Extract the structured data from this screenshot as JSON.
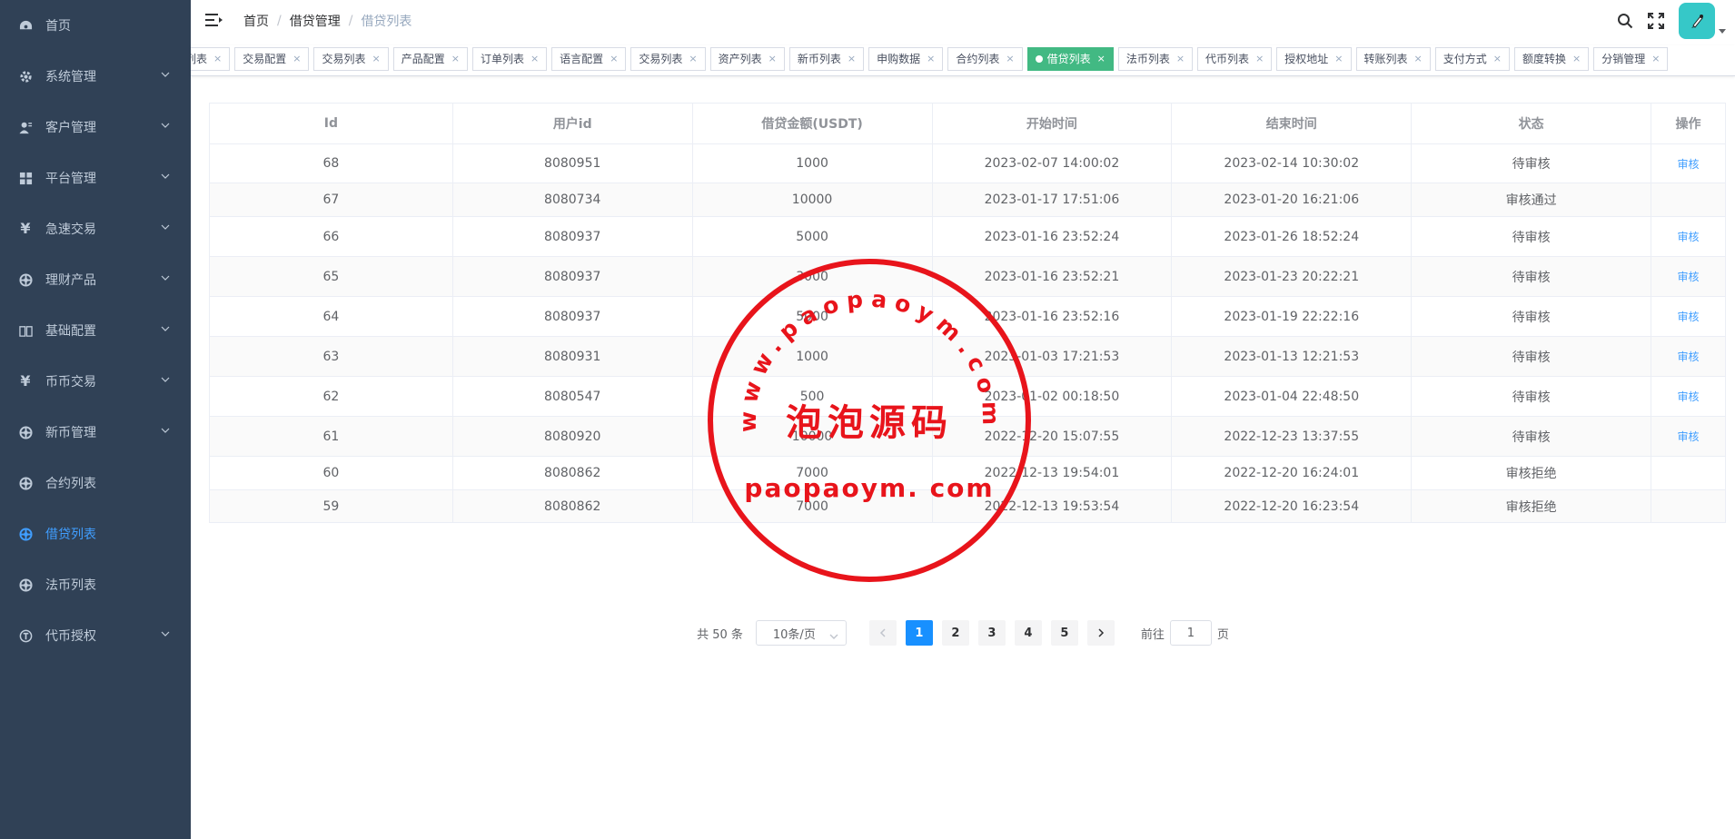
{
  "sidebar": {
    "items": [
      {
        "label": "首页",
        "icon": "dashboard-icon",
        "has_arrow": false,
        "active": false
      },
      {
        "label": "系统管理",
        "icon": "gear-icon",
        "has_arrow": true,
        "active": false
      },
      {
        "label": "客户管理",
        "icon": "user-icon",
        "has_arrow": true,
        "active": false
      },
      {
        "label": "平台管理",
        "icon": "grid-icon",
        "has_arrow": true,
        "active": false
      },
      {
        "label": "急速交易",
        "icon": "yen-icon",
        "has_arrow": true,
        "active": false
      },
      {
        "label": "理财产品",
        "icon": "aperture-icon",
        "has_arrow": true,
        "active": false
      },
      {
        "label": "基础配置",
        "icon": "book-icon",
        "has_arrow": true,
        "active": false
      },
      {
        "label": "币币交易",
        "icon": "yen-icon",
        "has_arrow": true,
        "active": false
      },
      {
        "label": "新币管理",
        "icon": "aperture-icon",
        "has_arrow": true,
        "active": false
      },
      {
        "label": "合约列表",
        "icon": "aperture-icon",
        "has_arrow": false,
        "active": false
      },
      {
        "label": "借贷列表",
        "icon": "aperture-icon",
        "has_arrow": false,
        "active": true
      },
      {
        "label": "法币列表",
        "icon": "aperture-icon",
        "has_arrow": false,
        "active": false
      },
      {
        "label": "代币授权",
        "icon": "token-icon",
        "has_arrow": true,
        "active": false
      }
    ]
  },
  "breadcrumb": [
    "首页",
    "借贷管理",
    "借贷列表"
  ],
  "tags": [
    {
      "label": "列表",
      "active": false
    },
    {
      "label": "交易配置",
      "active": false
    },
    {
      "label": "交易列表",
      "active": false
    },
    {
      "label": "产品配置",
      "active": false
    },
    {
      "label": "订单列表",
      "active": false
    },
    {
      "label": "语言配置",
      "active": false
    },
    {
      "label": "交易列表",
      "active": false
    },
    {
      "label": "资产列表",
      "active": false
    },
    {
      "label": "新币列表",
      "active": false
    },
    {
      "label": "申购数据",
      "active": false
    },
    {
      "label": "合约列表",
      "active": false
    },
    {
      "label": "借贷列表",
      "active": true
    },
    {
      "label": "法币列表",
      "active": false
    },
    {
      "label": "代币列表",
      "active": false
    },
    {
      "label": "授权地址",
      "active": false
    },
    {
      "label": "转账列表",
      "active": false
    },
    {
      "label": "支付方式",
      "active": false
    },
    {
      "label": "额度转换",
      "active": false
    },
    {
      "label": "分销管理",
      "active": false
    }
  ],
  "table": {
    "columns": [
      "Id",
      "用户id",
      "借贷金额(USDT)",
      "开始时间",
      "结束时间",
      "状态",
      "操作"
    ],
    "rows": [
      {
        "id": "68",
        "user_id": "8080951",
        "amount": "1000",
        "start": "2023-02-07 14:00:02",
        "end": "2023-02-14 10:30:02",
        "status": "待审核",
        "action": "审核"
      },
      {
        "id": "67",
        "user_id": "8080734",
        "amount": "10000",
        "start": "2023-01-17 17:51:06",
        "end": "2023-01-20 16:21:06",
        "status": "审核通过",
        "action": ""
      },
      {
        "id": "66",
        "user_id": "8080937",
        "amount": "5000",
        "start": "2023-01-16 23:52:24",
        "end": "2023-01-26 18:52:24",
        "status": "待审核",
        "action": "审核"
      },
      {
        "id": "65",
        "user_id": "8080937",
        "amount": "3000",
        "start": "2023-01-16 23:52:21",
        "end": "2023-01-23 20:22:21",
        "status": "待审核",
        "action": "审核"
      },
      {
        "id": "64",
        "user_id": "8080937",
        "amount": "5000",
        "start": "2023-01-16 23:52:16",
        "end": "2023-01-19 22:22:16",
        "status": "待审核",
        "action": "审核"
      },
      {
        "id": "63",
        "user_id": "8080931",
        "amount": "1000",
        "start": "2023-01-03 17:21:53",
        "end": "2023-01-13 12:21:53",
        "status": "待审核",
        "action": "审核"
      },
      {
        "id": "62",
        "user_id": "8080547",
        "amount": "500",
        "start": "2023-01-02 00:18:50",
        "end": "2023-01-04 22:48:50",
        "status": "待审核",
        "action": "审核"
      },
      {
        "id": "61",
        "user_id": "8080920",
        "amount": "10000",
        "start": "2022-12-20 15:07:55",
        "end": "2022-12-23 13:37:55",
        "status": "待审核",
        "action": "审核"
      },
      {
        "id": "60",
        "user_id": "8080862",
        "amount": "7000",
        "start": "2022-12-13 19:54:01",
        "end": "2022-12-20 16:24:01",
        "status": "审核拒绝",
        "action": ""
      },
      {
        "id": "59",
        "user_id": "8080862",
        "amount": "7000",
        "start": "2022-12-13 19:53:54",
        "end": "2022-12-20 16:23:54",
        "status": "审核拒绝",
        "action": ""
      }
    ]
  },
  "pagination": {
    "total_text": "共 50 条",
    "page_size": "10条/页",
    "pages": [
      "1",
      "2",
      "3",
      "4",
      "5"
    ],
    "current": "1",
    "goto_prefix": "前往",
    "goto_value": "1",
    "goto_suffix": "页"
  },
  "watermark": {
    "arc_text": "www.paopaoym.com",
    "center_text": "泡泡源码",
    "bottom_text": "paopaoym. com",
    "color": "#e8141b"
  },
  "colors": {
    "sidebar_bg": "#304156",
    "sidebar_text": "#bfcbd9",
    "sidebar_active": "#409eff",
    "tag_active": "#42b983",
    "link": "#409eff",
    "page_active": "#1890ff"
  }
}
